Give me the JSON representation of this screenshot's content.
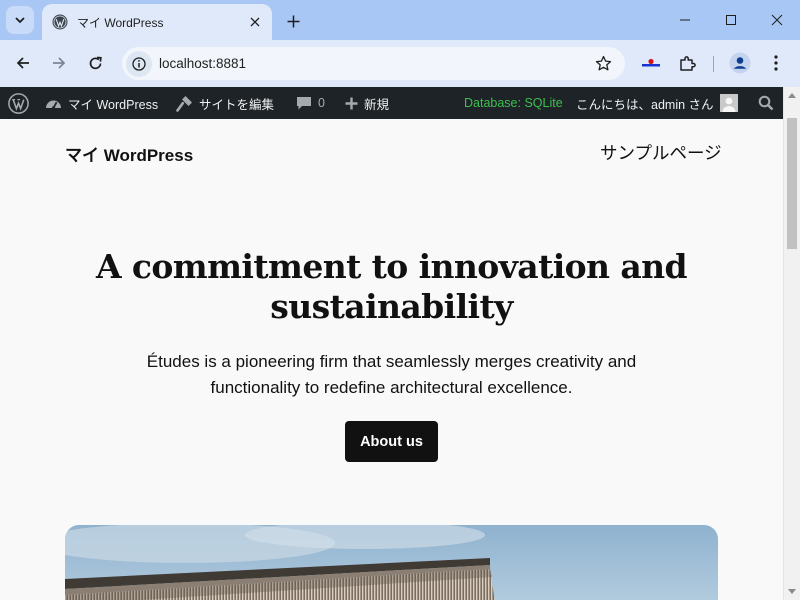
{
  "browser": {
    "tab": {
      "title": "マイ WordPress"
    },
    "address": {
      "url": "localhost:8881"
    },
    "colors": {
      "tabstrip": "#a9c7f5",
      "toolbar": "#dfe9f9",
      "omnibox": "#f2f6fc"
    },
    "icons": [
      "tab-search-icon",
      "wordpress-favicon-icon",
      "close-icon",
      "plus-icon",
      "minimize-icon",
      "maximize-icon",
      "back-arrow-icon",
      "forward-arrow-icon",
      "reload-icon",
      "site-info-icon",
      "star-icon",
      "extension-flag-icon",
      "puzzle-icon",
      "profile-icon",
      "more-vertical-icon"
    ]
  },
  "adminbar": {
    "site_name": "マイ WordPress",
    "edit_site": "サイトを編集",
    "comments_count": "0",
    "new_label": "新規",
    "database": "Database: SQLite",
    "greeting": "こんにちは、admin さん",
    "colors": {
      "background": "#1d2327",
      "database_text": "#3fbf4f"
    }
  },
  "site": {
    "title": "マイ WordPress",
    "nav": [
      "サンプルページ"
    ]
  },
  "hero": {
    "heading_lines": [
      "A commitment to innovation and",
      "sustainability"
    ],
    "text_lines": [
      "Études is a pioneering firm that seamlessly merges creativity and",
      "functionality to redefine architectural excellence."
    ],
    "button_label": "About us"
  }
}
